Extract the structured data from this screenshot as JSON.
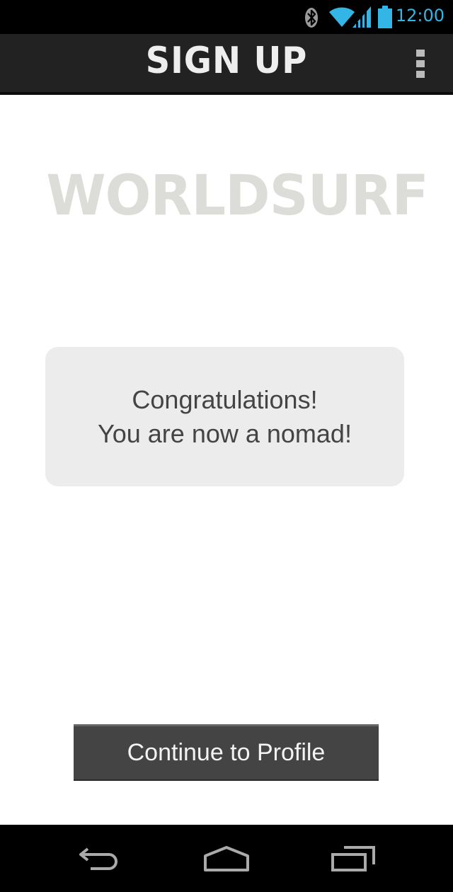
{
  "status_bar": {
    "time": "12:00",
    "icons": [
      "bluetooth-icon",
      "wifi-icon",
      "signal-icon",
      "battery-icon"
    ],
    "accent_color": "#33b5e5"
  },
  "action_bar": {
    "title": "SIGN UP",
    "overflow_icon": "overflow-menu-icon",
    "background": "#222222"
  },
  "logo": {
    "text": "WORLDSURF"
  },
  "message": {
    "line1": "Congratulations!",
    "line2": "You are now a nomad!"
  },
  "continue_button": {
    "label": "Continue to Profile"
  },
  "nav_bar": {
    "icons": [
      "back-icon",
      "home-icon",
      "recents-icon"
    ]
  }
}
